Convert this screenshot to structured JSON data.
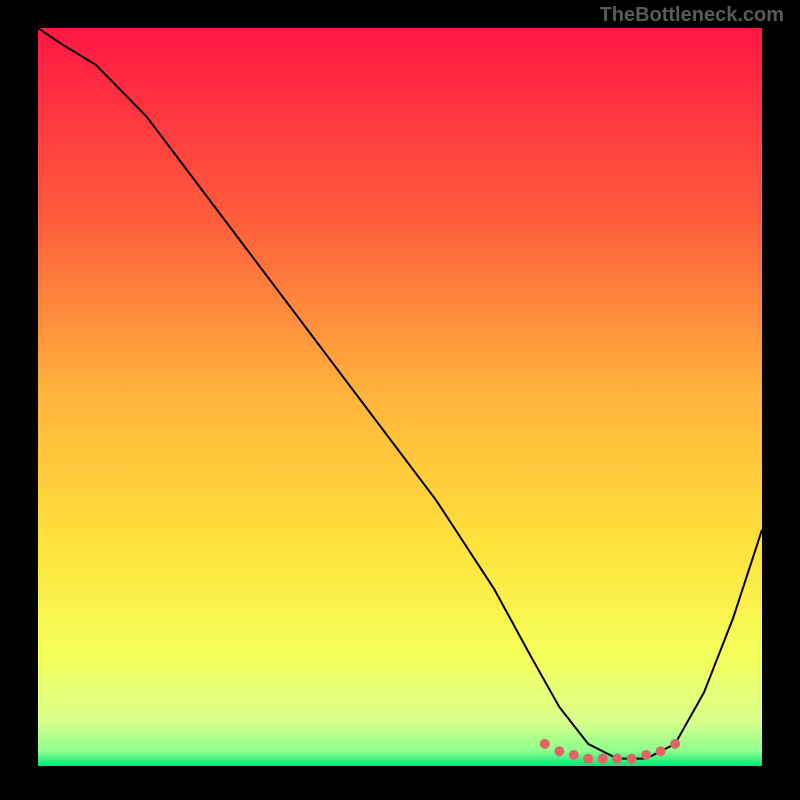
{
  "watermark": "TheBottleneck.com",
  "chart_data": {
    "type": "line",
    "title": "",
    "xlabel": "",
    "ylabel": "",
    "xlim": [
      0,
      100
    ],
    "ylim": [
      0,
      100
    ],
    "series": [
      {
        "name": "curve",
        "x": [
          0,
          3,
          8,
          15,
          25,
          35,
          45,
          55,
          63,
          68,
          72,
          76,
          80,
          84,
          88,
          92,
          96,
          100
        ],
        "y": [
          100,
          98,
          95,
          88,
          75,
          62,
          49,
          36,
          24,
          15,
          8,
          3,
          1,
          1,
          3,
          10,
          20,
          32
        ]
      }
    ],
    "markers": {
      "name": "highlight-points",
      "x": [
        70,
        72,
        74,
        76,
        78,
        80,
        82,
        84,
        86,
        88
      ],
      "y": [
        3,
        2,
        1.5,
        1,
        1,
        1,
        1,
        1.5,
        2,
        3
      ]
    },
    "gradient_stops": [
      {
        "offset": 0,
        "color": "#ff1744"
      },
      {
        "offset": 25,
        "color": "#ff5a3c"
      },
      {
        "offset": 50,
        "color": "#ffb43c"
      },
      {
        "offset": 70,
        "color": "#ffe23c"
      },
      {
        "offset": 85,
        "color": "#f5ff5a"
      },
      {
        "offset": 94,
        "color": "#d9ff8c"
      },
      {
        "offset": 98,
        "color": "#8cff8c"
      },
      {
        "offset": 100,
        "color": "#00e676"
      }
    ]
  }
}
